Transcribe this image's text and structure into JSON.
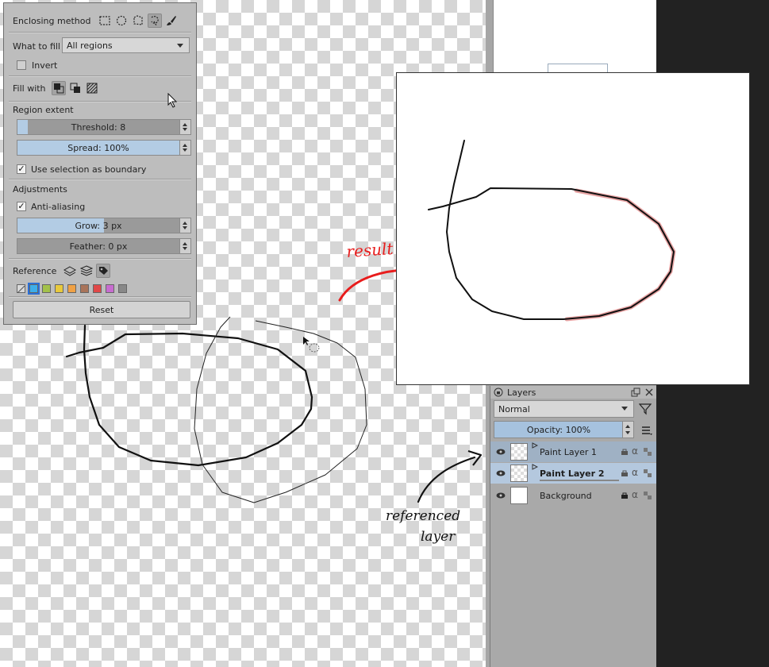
{
  "tool_options": {
    "enclosing_method_label": "Enclosing method",
    "enclosing_methods": [
      "rectangle-select-icon",
      "ellipse-select-icon",
      "polygon-select-icon",
      "lasso-select-icon",
      "brush-select-icon"
    ],
    "what_to_fill_label": "What to fill",
    "what_to_fill_value": "All regions",
    "invert_label": "Invert",
    "invert_checked": false,
    "fill_with_label": "Fill with",
    "region_extent_label": "Region extent",
    "threshold_label": "Threshold: 8",
    "threshold_fraction": 0.06,
    "spread_label": "Spread: 100%",
    "spread_fraction": 1.0,
    "use_selection_label": "Use selection as boundary",
    "use_selection_checked": true,
    "adjustments_label": "Adjustments",
    "anti_aliasing_label": "Anti-aliasing",
    "anti_aliasing_checked": true,
    "grow_label": "Grow: 3 px",
    "grow_fraction": 0.5,
    "feather_label": "Feather: 0 px",
    "feather_fraction": 0.0,
    "reference_label": "Reference",
    "reference_colors": [
      "#d9d9d9",
      "#3daee9",
      "#a3c14a",
      "#e8c93c",
      "#f0a145",
      "#a9745a",
      "#e04848",
      "#c76ccf",
      "#888888"
    ],
    "reset_label": "Reset"
  },
  "annotations": {
    "result_label": "result",
    "referenced_layer_line1": "referenced",
    "referenced_layer_line2": "layer"
  },
  "layers": {
    "title": "Layers",
    "blend_mode": "Normal",
    "opacity_label": "Opacity:  100%",
    "items": [
      {
        "name": "Paint Layer 1",
        "bold": false
      },
      {
        "name": "Paint Layer 2",
        "bold": true
      },
      {
        "name": "Background",
        "bold": false
      }
    ]
  },
  "colors": {
    "accent": "#3daee9",
    "annotation_red": "#e81c1c",
    "fill_result": "#e7a2a2"
  }
}
